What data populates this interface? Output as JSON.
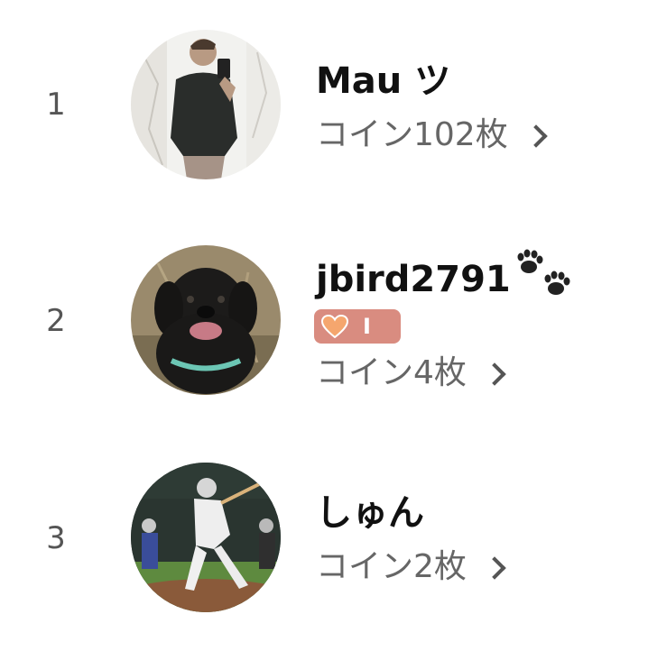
{
  "ranking": {
    "entries": [
      {
        "rank": "1",
        "name": "Mau ツ",
        "coins": "コイン102枚"
      },
      {
        "rank": "2",
        "name": "jbird2791",
        "coins": "コイン4枚",
        "badge_level": "I",
        "name_icon": "paw-prints-icon"
      },
      {
        "rank": "3",
        "name": "しゅん",
        "coins": "コイン2枚"
      }
    ]
  },
  "colors": {
    "rank_text": "#555555",
    "name_text": "#111111",
    "coin_text": "#666666",
    "badge_bg": "#d98c80",
    "heart": "#f5a66e"
  },
  "icons": {
    "chevron": "chevron-right-icon",
    "badge_heart": "heart-icon"
  }
}
